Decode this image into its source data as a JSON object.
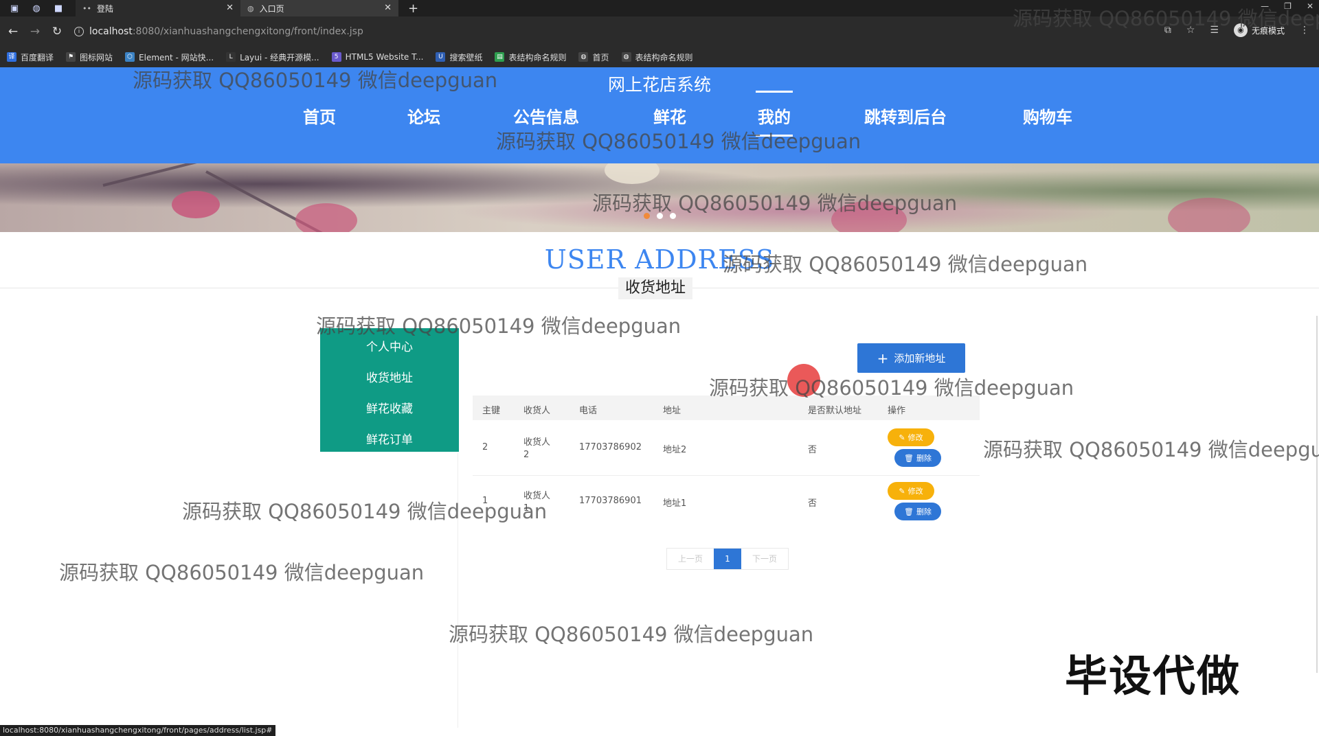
{
  "browser": {
    "tabs": [
      {
        "title": "登陆",
        "active": false
      },
      {
        "title": "入口页",
        "active": true
      }
    ],
    "url_host": "localhost",
    "url_rest": ":8080/xianhuashangchengxitong/front/index.jsp",
    "incognito_label": "无痕模式",
    "bookmarks": [
      "百度翻译",
      "图标网站",
      "Element - 网站快...",
      "Layui - 经典开源模...",
      "HTML5 Website T...",
      "搜索壁纸",
      "表结构命名规则",
      "首页",
      "表结构命名规则"
    ],
    "status_url": "localhost:8080/xianhuashangchengxitong/front/pages/address/list.jsp#"
  },
  "site": {
    "title": "网上花店系统",
    "nav": [
      "首页",
      "论坛",
      "公告信息",
      "鲜花",
      "我的",
      "跳转到后台",
      "购物车"
    ],
    "active_nav": "我的"
  },
  "page": {
    "title_en": "USER ADDRESS",
    "title_zh": "收货地址"
  },
  "left_menu": [
    "个人中心",
    "收货地址",
    "鲜花收藏",
    "鲜花订单"
  ],
  "add_button_label": "添加新地址",
  "table": {
    "headers": [
      "主键",
      "收货人",
      "电话",
      "地址",
      "是否默认地址",
      "操作"
    ],
    "rows": [
      {
        "id": "2",
        "name_line1": "收货人",
        "name_line2": "2",
        "phone": "17703786902",
        "address": "地址2",
        "is_default": "否"
      },
      {
        "id": "1",
        "name_line1": "收货人",
        "name_line2": "1",
        "phone": "17703786901",
        "address": "地址1",
        "is_default": "否"
      }
    ],
    "edit_label": "修改",
    "delete_label": "删除"
  },
  "pagination": {
    "prev": "上一页",
    "current": "1",
    "next": "下一页"
  },
  "watermark_text": "源码获取 QQ86050149 微信deepguan",
  "corner_text": "毕设代做",
  "colors": {
    "header_blue": "#3d86f0",
    "menu_green": "#0f9b85",
    "edit_yellow": "#f7b10b",
    "primary_blue": "#2e76d6"
  }
}
